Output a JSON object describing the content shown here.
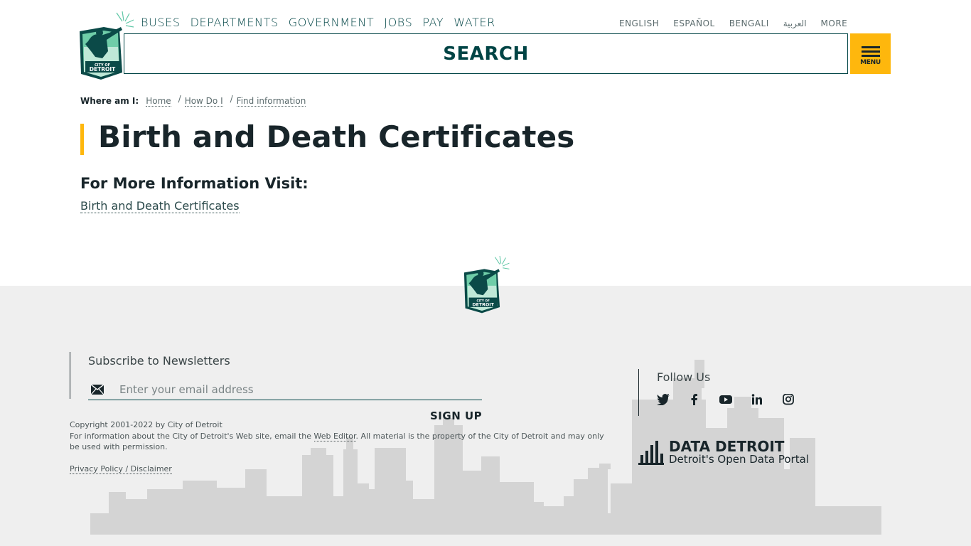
{
  "header": {
    "logo_alt": "City of Detroit",
    "nav": [
      "BUSES",
      "DEPARTMENTS",
      "GOVERNMENT",
      "JOBS",
      "PAY",
      "WATER"
    ],
    "languages": [
      "ENGLISH",
      "ESPAÑOL",
      "BENGALI",
      "العربية",
      "MORE"
    ],
    "search_label": "SEARCH",
    "menu_label": "MENU"
  },
  "breadcrumb": {
    "lead": "Where am I:",
    "items": [
      "Home",
      "How Do I",
      "Find information"
    ]
  },
  "page": {
    "title": "Birth and Death Certificates",
    "subheading": "For More Information Visit:",
    "link": "Birth and Death Certificates"
  },
  "footer": {
    "newsletter_title": "Subscribe to Newsletters",
    "email_placeholder": "Enter your email address",
    "signup_label": "SIGN UP",
    "copyright": "Copyright 2001-2022 by City of Detroit",
    "info_before": "For information about the City of Detroit's Web site, email the ",
    "web_editor": "Web Editor",
    "info_after": ". All material is the property of the City of Detroit and may only be used with permission.",
    "privacy": "Privacy Policy / Disclaimer",
    "follow_title": "Follow Us",
    "social_icons": [
      "twitter-icon",
      "facebook-icon",
      "youtube-icon",
      "linkedin-icon",
      "instagram-icon"
    ],
    "data_title": "DATA DETROIT",
    "data_subtitle": "Detroit's Open Data Portal"
  },
  "colors": {
    "accent_yellow": "#feb70d",
    "brand_teal": "#004445",
    "text_dark": "#18252a",
    "footer_bg": "#efefef",
    "skyline": "#d2d2d2"
  }
}
